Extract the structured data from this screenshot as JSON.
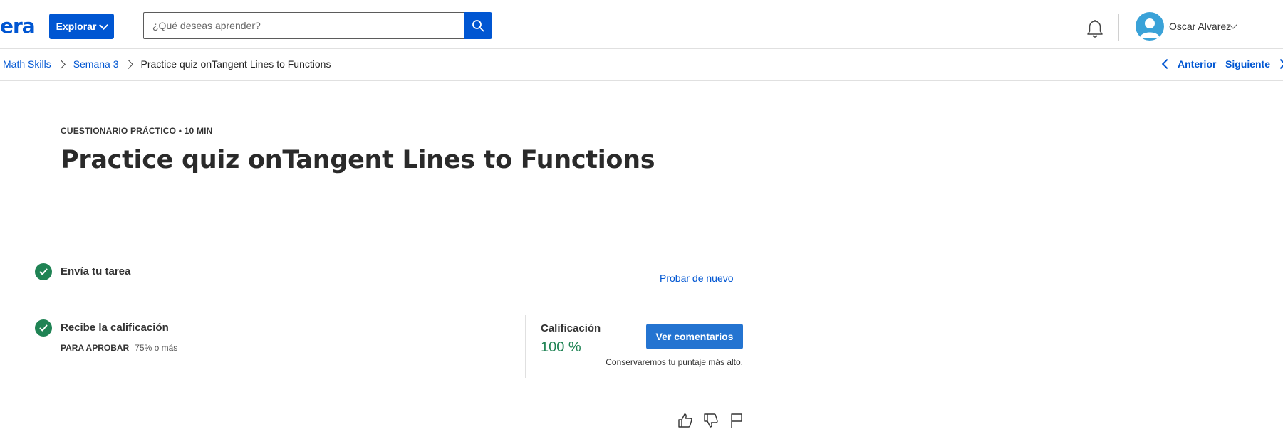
{
  "header": {
    "logo_text": "era",
    "explore_label": "Explorar",
    "search_placeholder": "¿Qué deseas aprender?",
    "user_name": "Oscar Alvarez",
    "brand_color": "#0056d2"
  },
  "breadcrumb": {
    "items": [
      "Math Skills",
      "Semana 3",
      "Practice quiz onTangent Lines to Functions"
    ],
    "prev_label": "Anterior",
    "next_label": "Siguiente"
  },
  "main": {
    "kicker": "CUESTIONARIO PRÁCTICO • 10 MIN",
    "title": "Practice quiz onTangent Lines to Functions",
    "submit_step": {
      "title": "Envía tu tarea",
      "action": "Probar de nuevo"
    },
    "grade_step": {
      "title": "Recibe la calificación",
      "pass_label": "PARA APROBAR",
      "pass_value": "75% o más",
      "grade_label": "Calificación",
      "grade_value": "100 %",
      "feedback_button": "Ver comentarios",
      "note": "Conservaremos tu puntaje más alto."
    },
    "success_color": "#1f8354"
  },
  "icons": [
    "bell-icon",
    "search-icon",
    "avatar-icon",
    "check-icon",
    "thumbs-up-icon",
    "thumbs-down-icon",
    "flag-icon"
  ]
}
